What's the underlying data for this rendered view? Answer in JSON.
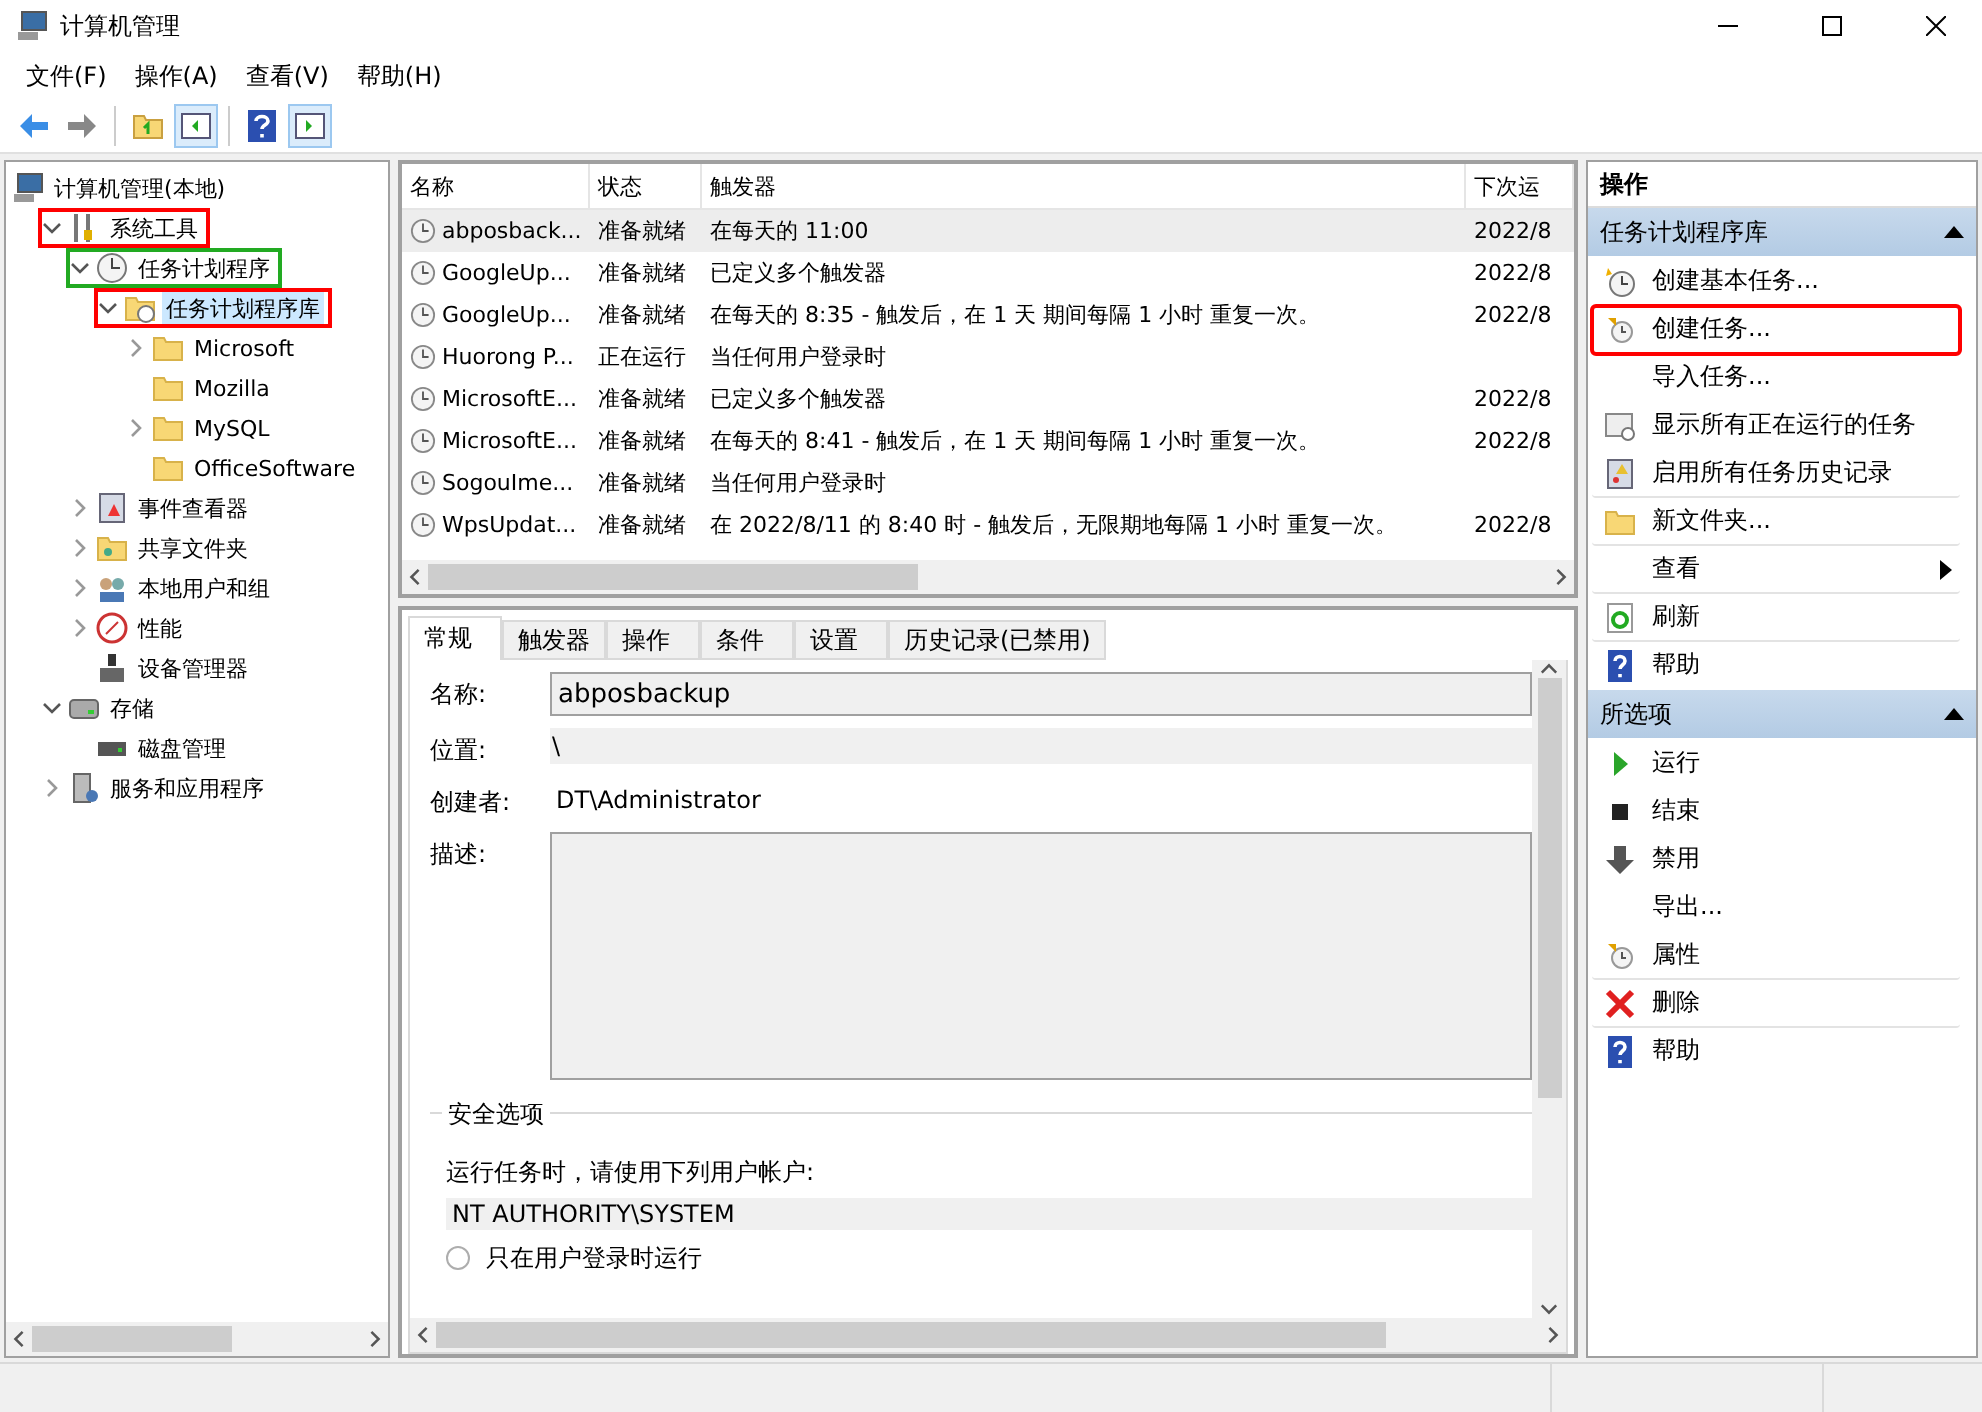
{
  "window": {
    "title": "计算机管理"
  },
  "menu": [
    "文件(F)",
    "操作(A)",
    "查看(V)",
    "帮助(H)"
  ],
  "tree": [
    {
      "label": "计算机管理(本地)",
      "kind": "computer",
      "selected": false,
      "children": [
        {
          "label": "系统工具",
          "kind": "tools",
          "expanded": true,
          "selected": false,
          "color": "#ff0000",
          "children": [
            {
              "label": "任务计划程序",
              "kind": "clock",
              "expanded": true,
              "selected": false,
              "color": "#22aa22",
              "children": [
                {
                  "label": "任务计划程序库",
                  "kind": "library",
                  "expanded": true,
                  "selected": true,
                  "color": "#ff0000",
                  "children": [
                    {
                      "label": "Microsoft",
                      "kind": "folder",
                      "expanded": false,
                      "selected": false
                    },
                    {
                      "label": "Mozilla",
                      "kind": "folder",
                      "selected": false
                    },
                    {
                      "label": "MySQL",
                      "kind": "folder",
                      "expanded": false,
                      "selected": false
                    },
                    {
                      "label": "OfficeSoftware",
                      "kind": "folder",
                      "selected": false
                    }
                  ]
                }
              ]
            },
            {
              "label": "事件查看器",
              "kind": "events",
              "expanded": false,
              "selected": false
            },
            {
              "label": "共享文件夹",
              "kind": "share",
              "expanded": false,
              "selected": false
            },
            {
              "label": "本地用户和组",
              "kind": "users",
              "expanded": false,
              "selected": false
            },
            {
              "label": "性能",
              "kind": "perf",
              "expanded": false,
              "selected": false
            },
            {
              "label": "设备管理器",
              "kind": "device",
              "selected": false
            }
          ]
        },
        {
          "label": "存储",
          "kind": "storage",
          "expanded": true,
          "selected": false,
          "children": [
            {
              "label": "磁盘管理",
              "kind": "disk",
              "selected": false
            }
          ]
        },
        {
          "label": "服务和应用程序",
          "kind": "services",
          "expanded": false,
          "selected": false
        }
      ]
    }
  ],
  "table": {
    "columns": [
      "名称",
      "状态",
      "触发器",
      "下次运"
    ],
    "rows": [
      {
        "name": "abposback...",
        "status": "准备就绪",
        "trigger": "在每天的 11:00",
        "next_run": "2022/8",
        "selected": true
      },
      {
        "name": "GoogleUp...",
        "status": "准备就绪",
        "trigger": "已定义多个触发器",
        "next_run": "2022/8",
        "selected": false
      },
      {
        "name": "GoogleUp...",
        "status": "准备就绪",
        "trigger": "在每天的 8:35 - 触发后，在 1 天 期间每隔 1 小时 重复一次。",
        "next_run": "2022/8",
        "selected": false
      },
      {
        "name": "Huorong P...",
        "status": "正在运行",
        "trigger": "当任何用户登录时",
        "selected": false
      },
      {
        "name": "MicrosoftE...",
        "status": "准备就绪",
        "trigger": "已定义多个触发器",
        "next_run": "2022/8",
        "selected": false
      },
      {
        "name": "MicrosoftE...",
        "status": "准备就绪",
        "trigger": "在每天的 8:41 - 触发后，在 1 天 期间每隔 1 小时 重复一次。",
        "next_run": "2022/8",
        "selected": false
      },
      {
        "name": "SogouIme...",
        "status": "准备就绪",
        "trigger": "当任何用户登录时",
        "selected": false
      },
      {
        "name": "WpsUpdat...",
        "status": "准备就绪",
        "trigger": "在 2022/8/11 的 8:40 时 - 触发后，无限期地每隔 1 小时 重复一次。",
        "next_run": "2022/8",
        "selected": false
      }
    ]
  },
  "details": {
    "tabs": [
      {
        "label": "常规",
        "selected": true
      },
      {
        "label": "触发器",
        "selected": false
      },
      {
        "label": "操作",
        "selected": false
      },
      {
        "label": "条件",
        "selected": false
      },
      {
        "label": "设置",
        "selected": false
      },
      {
        "label": "历史记录(已禁用)",
        "selected": false
      }
    ],
    "fields": [
      {
        "label": "名称:",
        "value": "abposbackup",
        "kind": "input"
      },
      {
        "label": "位置:",
        "value": "\\",
        "kind": "readonly"
      },
      {
        "label": "创建者:",
        "value": "DT\\Administrator",
        "kind": "text"
      },
      {
        "label": "描述:",
        "kind": "textarea"
      }
    ],
    "security": {
      "title": "安全选项",
      "prompt": "运行任务时，请使用下列用户帐户:",
      "account": "NT AUTHORITY\\SYSTEM",
      "options": [
        {
          "label": "只在用户登录时运行",
          "selected": false
        }
      ]
    }
  },
  "actions": {
    "title": "操作",
    "sections": [
      {
        "title": "任务计划程序库",
        "expanded": true,
        "items": [
          {
            "label": "创建基本任务...",
            "kind": "new-task"
          },
          {
            "label": "创建任务...",
            "kind": "task",
            "color": "#ff0000"
          },
          {
            "label": "导入任务...",
            "kind": "plain"
          },
          {
            "label": "显示所有正在运行的任务",
            "kind": "running"
          },
          {
            "label": "启用所有任务历史记录",
            "kind": "history"
          },
          {
            "label": "新文件夹...",
            "kind": "folder"
          },
          {
            "label": "查看",
            "kind": "submenu"
          },
          {
            "label": "刷新",
            "kind": "refresh"
          },
          {
            "label": "帮助",
            "kind": "help"
          }
        ]
      },
      {
        "title": "所选项",
        "expanded": true,
        "items": [
          {
            "label": "运行",
            "kind": "run"
          },
          {
            "label": "结束",
            "kind": "stop"
          },
          {
            "label": "禁用",
            "kind": "disable"
          },
          {
            "label": "导出...",
            "kind": "plain"
          },
          {
            "label": "属性",
            "kind": "task"
          },
          {
            "label": "删除",
            "kind": "delete"
          },
          {
            "label": "帮助",
            "kind": "help"
          }
        ]
      }
    ]
  }
}
